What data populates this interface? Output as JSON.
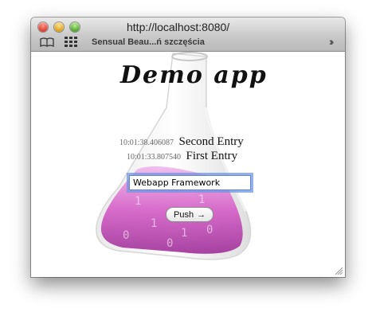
{
  "window": {
    "title": "http://localhost:8080/",
    "bookmark_label": "Sensual Beau...ń szczęścia",
    "icons": [
      "close-light",
      "minimize-light",
      "zoom-light",
      "bookmarks-book-icon",
      "grid-icon",
      "chevron-double-right-icon"
    ]
  },
  "page": {
    "title": "Demo app",
    "entries": [
      {
        "timestamp": "10:01:38.406087",
        "text": "Second Entry"
      },
      {
        "timestamp": "10:01:33.807540",
        "text": "First Entry"
      }
    ],
    "input_value": "Webapp Framework",
    "push_label": "Push",
    "push_arrow": "→"
  },
  "colors": {
    "flask_liquid": "#d45cc6",
    "input_focus": "#6e96e1"
  }
}
